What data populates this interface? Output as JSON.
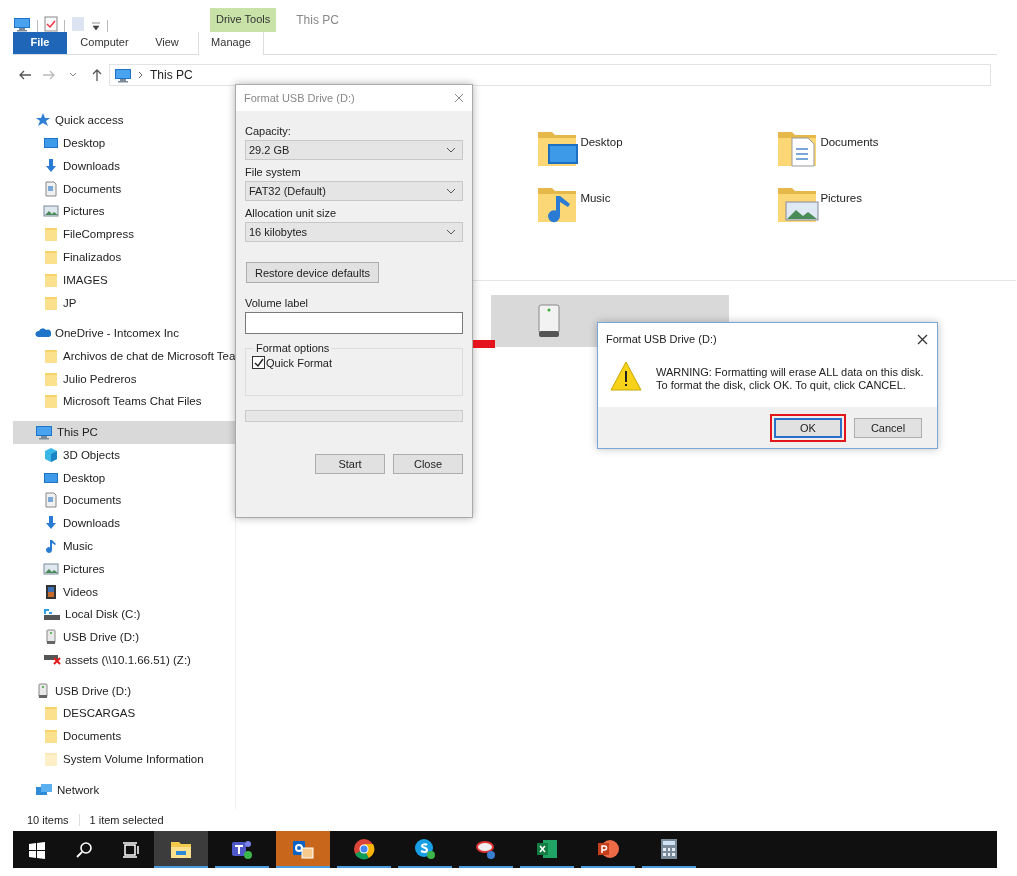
{
  "ribbon": {
    "context_tab_group": "Drive Tools",
    "title": "This PC",
    "tabs": [
      {
        "label": "File",
        "kind": "file",
        "selected": false
      },
      {
        "label": "Computer",
        "kind": "normal",
        "selected": false
      },
      {
        "label": "View",
        "kind": "normal",
        "selected": false
      },
      {
        "label": "Manage",
        "kind": "context",
        "selected": true
      }
    ]
  },
  "address_bar": {
    "path": [
      "This PC"
    ]
  },
  "sidebar": {
    "items": [
      {
        "label": "Quick access",
        "kind": "star",
        "selected": false,
        "children": [
          {
            "label": "Desktop",
            "kind": "desktop",
            "selected": false
          },
          {
            "label": "Downloads",
            "kind": "download",
            "selected": false
          },
          {
            "label": "Documents",
            "kind": "documents",
            "selected": false
          },
          {
            "label": "Pictures",
            "kind": "pictures",
            "selected": false
          },
          {
            "label": "FileCompress",
            "kind": "folder",
            "selected": false
          },
          {
            "label": "Finalizados",
            "kind": "folder",
            "selected": false
          },
          {
            "label": "IMAGES",
            "kind": "folder",
            "selected": false
          },
          {
            "label": "JP",
            "kind": "folder",
            "selected": false
          }
        ]
      },
      {
        "label": "OneDrive - Intcomex Inc",
        "kind": "cloud",
        "selected": false,
        "children": [
          {
            "label": "Archivos de chat de Microsoft Tea",
            "kind": "folder",
            "selected": false
          },
          {
            "label": "Julio Pedreros",
            "kind": "folder",
            "selected": false
          },
          {
            "label": "Microsoft Teams Chat Files",
            "kind": "folder",
            "selected": false
          }
        ]
      },
      {
        "label": "This PC",
        "kind": "pc",
        "selected": true,
        "children": [
          {
            "label": "3D Objects",
            "kind": "cube",
            "selected": false
          },
          {
            "label": "Desktop",
            "kind": "desktop",
            "selected": false
          },
          {
            "label": "Documents",
            "kind": "documents",
            "selected": false
          },
          {
            "label": "Downloads",
            "kind": "download",
            "selected": false
          },
          {
            "label": "Music",
            "kind": "music",
            "selected": false
          },
          {
            "label": "Pictures",
            "kind": "pictures",
            "selected": false
          },
          {
            "label": "Videos",
            "kind": "videos",
            "selected": false
          },
          {
            "label": "Local Disk (C:)",
            "kind": "disk",
            "selected": false
          },
          {
            "label": "USB Drive (D:)",
            "kind": "usb",
            "selected": false
          },
          {
            "label": "assets (\\\\10.1.66.51) (Z:)",
            "kind": "netdrive",
            "selected": false
          }
        ]
      },
      {
        "label": "USB Drive (D:)",
        "kind": "usb",
        "selected": false,
        "children": [
          {
            "label": "DESCARGAS",
            "kind": "folder",
            "selected": false
          },
          {
            "label": "Documents",
            "kind": "folder",
            "selected": false
          },
          {
            "label": "System Volume Information",
            "kind": "hiddenfolder",
            "selected": false
          }
        ]
      },
      {
        "label": "Network",
        "kind": "network",
        "selected": false
      }
    ]
  },
  "folders": [
    {
      "label": "Desktop",
      "kind": "desktop"
    },
    {
      "label": "Documents",
      "kind": "documents"
    },
    {
      "label": "Music",
      "kind": "music"
    },
    {
      "label": "Pictures",
      "kind": "pictures"
    }
  ],
  "drives": [
    {
      "kind": "usb",
      "selected": true
    }
  ],
  "status_bar": {
    "count": "10 items",
    "selection": "1 item selected"
  },
  "format_dialog": {
    "title": "Format USB Drive (D:)",
    "fields": [
      {
        "label": "Capacity:",
        "value": "29.2 GB"
      },
      {
        "label": "File system",
        "value": "FAT32 (Default)"
      },
      {
        "label": "Allocation unit size",
        "value": "16 kilobytes"
      }
    ],
    "restore_button": "Restore device defaults",
    "volume_label": {
      "label": "Volume label"
    },
    "format_options": {
      "legend": "Format options",
      "options": [
        {
          "label": "Quick Format",
          "checked": true
        }
      ]
    },
    "progress": {
      "level": 0
    },
    "buttons": [
      "Start",
      "Close"
    ]
  },
  "message_box": {
    "title": "Format USB Drive (D:)",
    "lines": [
      "WARNING: Formatting will erase ALL data on this disk.",
      "To format the disk, click OK. To quit, click CANCEL."
    ],
    "buttons": [
      {
        "label": "OK",
        "selected": true
      },
      {
        "label": "Cancel",
        "selected": false
      }
    ]
  },
  "taskbar": {
    "apps": [
      {
        "kind": "start",
        "running": false,
        "active": false,
        "highlighted": false
      },
      {
        "kind": "search",
        "running": false,
        "active": false,
        "highlighted": false
      },
      {
        "kind": "taskview",
        "running": false,
        "active": false,
        "highlighted": false
      },
      {
        "kind": "explorer",
        "running": true,
        "active": true,
        "highlighted": false
      },
      {
        "kind": "teams",
        "running": true,
        "active": false,
        "highlighted": false
      },
      {
        "kind": "outlook",
        "running": true,
        "active": false,
        "highlighted": true
      },
      {
        "kind": "chrome",
        "running": true,
        "active": false,
        "highlighted": false
      },
      {
        "kind": "skype",
        "running": true,
        "active": false,
        "highlighted": false
      },
      {
        "kind": "netapp",
        "running": true,
        "active": false,
        "highlighted": false
      },
      {
        "kind": "excel",
        "running": true,
        "active": false,
        "highlighted": false
      },
      {
        "kind": "powerpoint",
        "running": true,
        "active": false,
        "highlighted": false
      },
      {
        "kind": "calculator",
        "running": true,
        "active": false,
        "highlighted": false
      }
    ]
  }
}
